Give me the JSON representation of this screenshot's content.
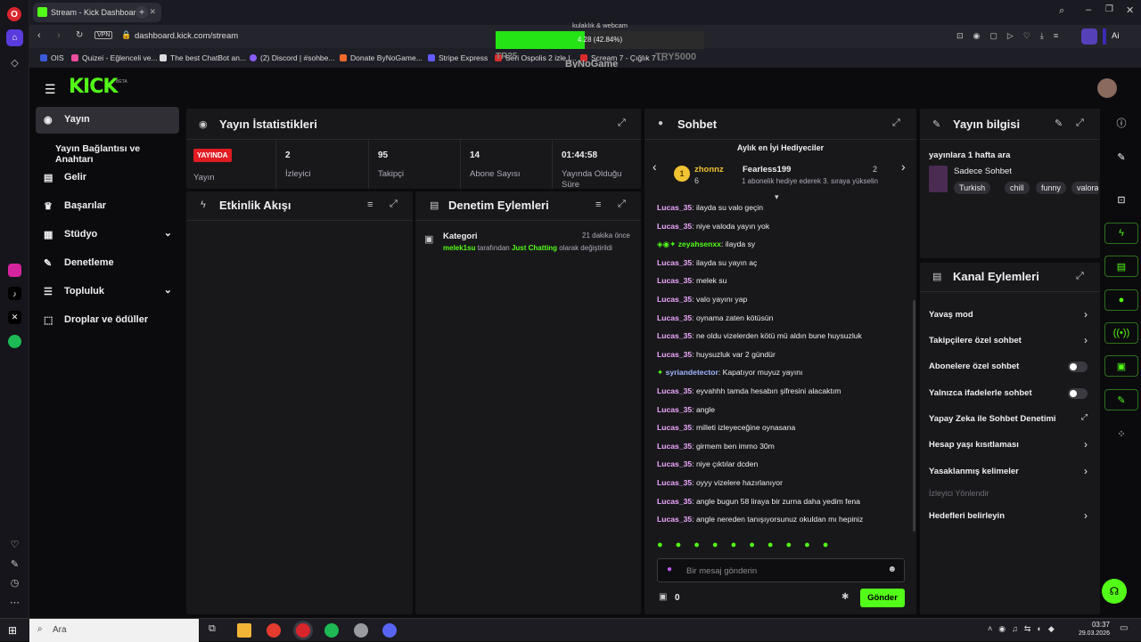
{
  "browser": {
    "tab_title": "Stream - Kick Dashboard",
    "url": "dashboard.kick.com/stream",
    "vpn": "VPN",
    "ai_label": "Ai",
    "bookmarks": [
      "OIS",
      "Quizei - Eğlenceli ve...",
      "The best ChatBot an...",
      "(2) Discord | #sohbe...",
      "Donate ByNoGame...",
      "Stripe Express",
      "Seri Ospolis 2 izle |...",
      "Scream 7 - Çığlık 7 i..."
    ],
    "overlay_title": "kulaklık & webcam",
    "overlay_text": "4.28 (42.84%)",
    "overlay_progress": 0.4284,
    "overlay_logo": "ByNoGame",
    "overlay_code": "TRY5000",
    "overlay_prefix": "TR25"
  },
  "kick": {
    "logo": "KICK",
    "beta": "BETA",
    "nav": [
      {
        "label": "Yayın",
        "icon": "stream-icon"
      },
      {
        "label": "Yayın Bağlantısı ve Anahtarı",
        "icon": ""
      },
      {
        "label": "Gelir",
        "icon": "revenue-icon"
      },
      {
        "label": "Başarılar",
        "icon": "trophy-icon"
      },
      {
        "label": "Stüdyo",
        "icon": "studio-icon"
      },
      {
        "label": "Denetleme",
        "icon": "wrench-icon"
      },
      {
        "label": "Topluluk",
        "icon": "community-icon"
      },
      {
        "label": "Droplar ve ödüller",
        "icon": "drops-icon"
      }
    ]
  },
  "stats": {
    "title": "Yayın İstatistikleri",
    "live_badge": "YAYINDA",
    "live_label": "Yayın",
    "items": [
      {
        "value": "2",
        "label": "İzleyici"
      },
      {
        "value": "95",
        "label": "Takipçi"
      },
      {
        "value": "14",
        "label": "Abone Sayısı"
      },
      {
        "value": "01:44:58",
        "label": "Yayında Olduğu Süre"
      }
    ]
  },
  "activity": {
    "title": "Etkinlik Akışı"
  },
  "moderation": {
    "title": "Denetim Eylemleri",
    "entry_title": "Kategori",
    "entry_time": "21 dakika önce",
    "entry_user": "melek1su",
    "entry_mid": " tarafından ",
    "entry_cat": "Just Chatting",
    "entry_end": " olarak değiştirildi"
  },
  "chat": {
    "title": "Sohbet",
    "gifters_title": "Aylık en İyi Hediyeciler",
    "gifter1": "zhonnz",
    "gifter1_count": "6",
    "gifter2": "Fearless199",
    "gifter2_count": "2",
    "gifter2_note": "1 abonelik hediye ederek 3. sıraya yükselin",
    "messages": [
      {
        "user": "Lucas_35",
        "text": "ilayda su valo geçin"
      },
      {
        "user": "Lucas_35",
        "text": "niye valoda yayın yok"
      },
      {
        "user": "zeyahsenxx",
        "text": "ilayda sy"
      },
      {
        "user": "Lucas_35",
        "text": "ilayda su yayın aç"
      },
      {
        "user": "Lucas_35",
        "text": "melek su"
      },
      {
        "user": "Lucas_35",
        "text": "valo yayını yap"
      },
      {
        "user": "Lucas_35",
        "text": "oynama zaten kötüsün"
      },
      {
        "user": "Lucas_35",
        "text": "ne oldu vizelerden kötü mü aldın bune huysuzluk"
      },
      {
        "user": "Lucas_35",
        "text": "huysuzluk var 2 gündür"
      },
      {
        "user": "syriandetector",
        "text": "Kapatıyor muyuz yayını"
      },
      {
        "user": "Lucas_35",
        "text": "eyvahhh tamda hesabın şifresini alacaktım"
      },
      {
        "user": "Lucas_35",
        "text": "angle"
      },
      {
        "user": "Lucas_35",
        "text": "milleti izleyeceğine oynasana"
      },
      {
        "user": "Lucas_35",
        "text": "girmem ben immo 30m"
      },
      {
        "user": "Lucas_35",
        "text": "niye çıktılar dcden"
      },
      {
        "user": "Lucas_35",
        "text": "oyyy vizelere hazırlanıyor"
      },
      {
        "user": "Lucas_35",
        "text": "angle bugun 58 liraya bir zurna daha yedim fena"
      },
      {
        "user": "Lucas_35",
        "text": "angle nereden tanışıyorsunuz okuldan mı hepiniz"
      }
    ],
    "placeholder": "Bir mesaj gönderin",
    "count": "0",
    "send": "Gönder"
  },
  "info": {
    "title": "Yayın bilgisi",
    "stream_title": "yayınlara 1 hafta ara",
    "category": "Sadece Sohbet",
    "tags": [
      "Turkish",
      "chill",
      "funny",
      "valora"
    ]
  },
  "channel": {
    "title": "Kanal Eylemleri",
    "actions": [
      {
        "label": "Yavaş mod",
        "type": "chevron"
      },
      {
        "label": "Takipçilere özel sohbet",
        "type": "chevron"
      },
      {
        "label": "Abonelere özel sohbet",
        "type": "toggle"
      },
      {
        "label": "Yalnızca ifadelerle sohbet",
        "type": "toggle"
      },
      {
        "label": "Yapay Zeka ile Sohbet Denetimi",
        "type": "external"
      },
      {
        "label": "Hesap yaşı kısıtlaması",
        "type": "chevron"
      },
      {
        "label": "Yasaklanmış kelimeler",
        "type": "chevron"
      }
    ],
    "section": "İzleyici Yönlendir",
    "goals": "Hedefleri belirleyin"
  },
  "taskbar": {
    "search": "Ara",
    "time": "03:37",
    "date": "29.03.2026"
  },
  "colors": {
    "accent": "#53fc18",
    "live": "#e11b22",
    "panel": "#18181b"
  }
}
